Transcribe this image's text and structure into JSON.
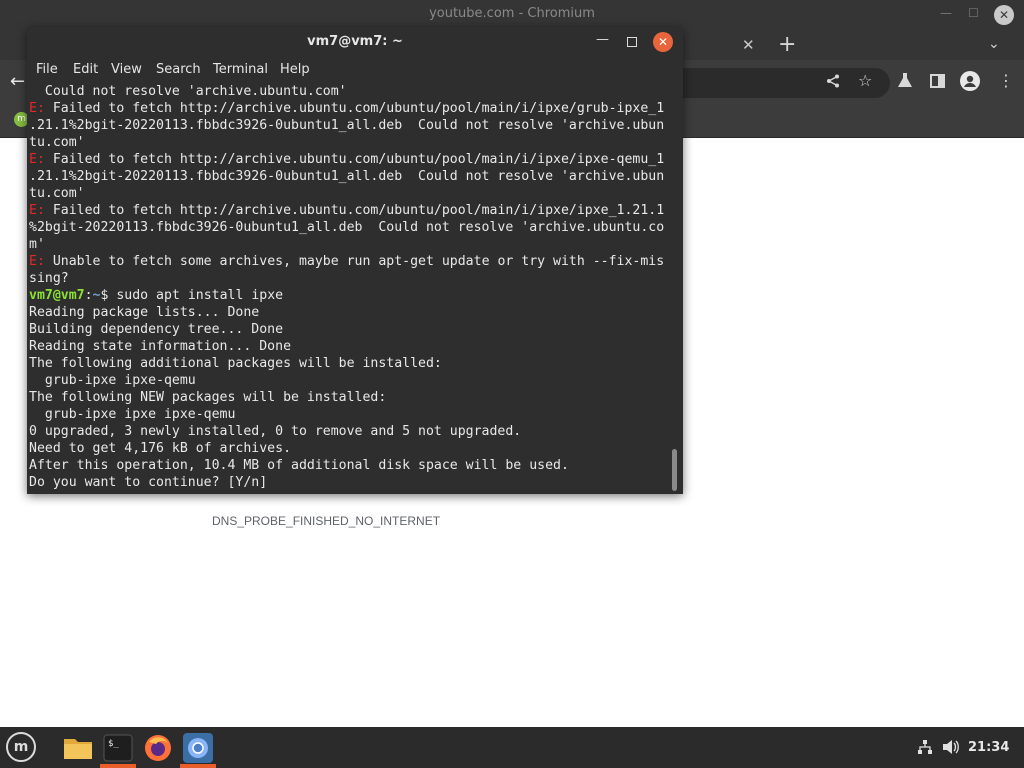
{
  "chromium": {
    "window_title": "youtube.com - Chromium",
    "bookmark_icon": "linux-mint-icon",
    "error_code": "DNS_PROBE_FINISHED_NO_INTERNET"
  },
  "terminal": {
    "title": "vm7@vm7: ~",
    "menu": [
      "File",
      "Edit",
      "View",
      "Search",
      "Terminal",
      "Help"
    ],
    "lines": [
      [
        {
          "t": "  Could not resolve 'archive.ubuntu.com'"
        }
      ],
      [
        {
          "t": "E:",
          "c": "err"
        },
        {
          "t": " Failed to fetch http://archive.ubuntu.com/ubuntu/pool/main/i/ipxe/grub-ipxe_1"
        }
      ],
      [
        {
          "t": ".21.1%2bgit-20220113.fbbdc3926-0ubuntu1_all.deb  Could not resolve 'archive.ubun"
        }
      ],
      [
        {
          "t": "tu.com'"
        }
      ],
      [
        {
          "t": "E:",
          "c": "err"
        },
        {
          "t": " Failed to fetch http://archive.ubuntu.com/ubuntu/pool/main/i/ipxe/ipxe-qemu_1"
        }
      ],
      [
        {
          "t": ".21.1%2bgit-20220113.fbbdc3926-0ubuntu1_all.deb  Could not resolve 'archive.ubun"
        }
      ],
      [
        {
          "t": "tu.com'"
        }
      ],
      [
        {
          "t": "E:",
          "c": "err"
        },
        {
          "t": " Failed to fetch http://archive.ubuntu.com/ubuntu/pool/main/i/ipxe/ipxe_1.21.1"
        }
      ],
      [
        {
          "t": "%2bgit-20220113.fbbdc3926-0ubuntu1_all.deb  Could not resolve 'archive.ubuntu.co"
        }
      ],
      [
        {
          "t": "m'"
        }
      ],
      [
        {
          "t": "E:",
          "c": "err"
        },
        {
          "t": " Unable to fetch some archives, maybe run apt-get update or try with --fix-mis"
        }
      ],
      [
        {
          "t": "sing?"
        }
      ],
      [
        {
          "t": "vm7@vm7",
          "c": "pu"
        },
        {
          "t": ":"
        },
        {
          "t": "~",
          "c": "pp"
        },
        {
          "t": "$ sudo apt install ipxe"
        }
      ],
      [
        {
          "t": "Reading package lists... Done"
        }
      ],
      [
        {
          "t": "Building dependency tree... Done"
        }
      ],
      [
        {
          "t": "Reading state information... Done"
        }
      ],
      [
        {
          "t": "The following additional packages will be installed:"
        }
      ],
      [
        {
          "t": "  grub-ipxe ipxe-qemu"
        }
      ],
      [
        {
          "t": "The following NEW packages will be installed:"
        }
      ],
      [
        {
          "t": "  grub-ipxe ipxe ipxe-qemu"
        }
      ],
      [
        {
          "t": "0 upgraded, 3 newly installed, 0 to remove and 5 not upgraded."
        }
      ],
      [
        {
          "t": "Need to get 4,176 kB of archives."
        }
      ],
      [
        {
          "t": "After this operation, 10.4 MB of additional disk space will be used."
        }
      ],
      [
        {
          "t": "Do you want to continue? [Y/n]"
        }
      ]
    ]
  },
  "taskbar": {
    "clock": "21:34",
    "launchers": [
      "files-icon",
      "terminal-icon",
      "firefox-icon",
      "chromium-icon"
    ]
  },
  "colors": {
    "error": "#e02a2a",
    "prompt_user": "#8ae234",
    "prompt_path": "#729fcf",
    "close_button": "#e9663d",
    "active_marker": "#e85d2a"
  }
}
